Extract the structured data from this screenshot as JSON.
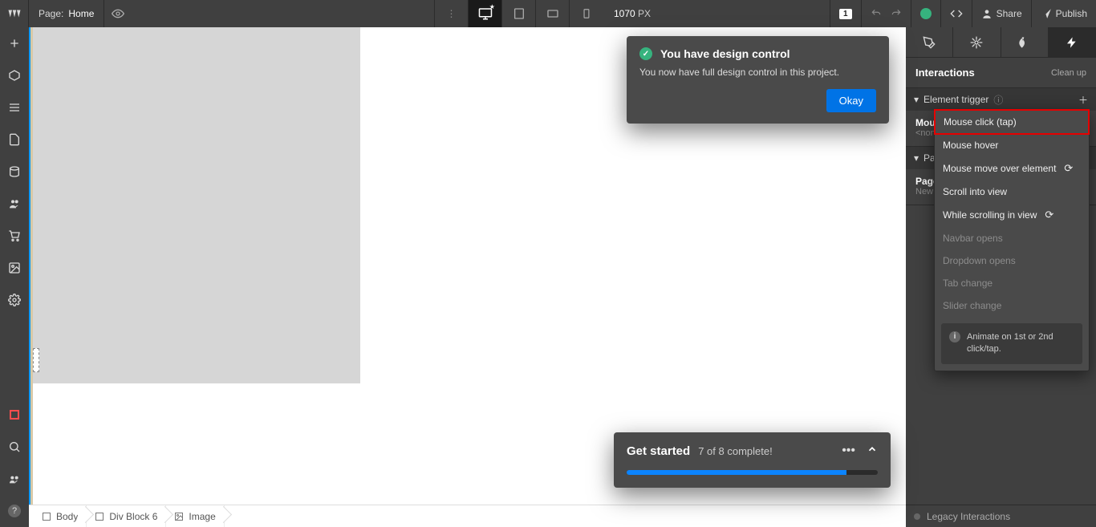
{
  "top": {
    "page_label": "Page:",
    "page_name": "Home",
    "canvas_width": "1070",
    "px_unit": "PX",
    "user_count": "1",
    "share": "Share",
    "publish": "Publish"
  },
  "breadcrumb": {
    "items": [
      "Body",
      "Div Block 6",
      "Image"
    ]
  },
  "panel": {
    "title": "Interactions",
    "cleanup": "Clean up",
    "section_trigger": "Element trigger",
    "row_mouse": "Mous",
    "row_none": "<non",
    "section_page": "Pa",
    "row_page_title": "Page",
    "row_page_sub": "New",
    "legacy": "Legacy Interactions"
  },
  "dropdown": {
    "items": [
      {
        "label": "Mouse click (tap)",
        "hl": true
      },
      {
        "label": "Mouse hover"
      },
      {
        "label": "Mouse move over element",
        "refresh": true
      },
      {
        "label": "Scroll into view"
      },
      {
        "label": "While scrolling in view",
        "refresh": true
      },
      {
        "label": "Navbar opens",
        "disabled": true
      },
      {
        "label": "Dropdown opens",
        "disabled": true
      },
      {
        "label": "Tab change",
        "disabled": true
      },
      {
        "label": "Slider change",
        "disabled": true
      }
    ],
    "info": "Animate on 1st or 2nd click/tap."
  },
  "toast": {
    "title": "You have design control",
    "text": "You now have full design control in this project.",
    "ok": "Okay"
  },
  "gs": {
    "title": "Get started",
    "progress": "7 of 8 complete!"
  }
}
